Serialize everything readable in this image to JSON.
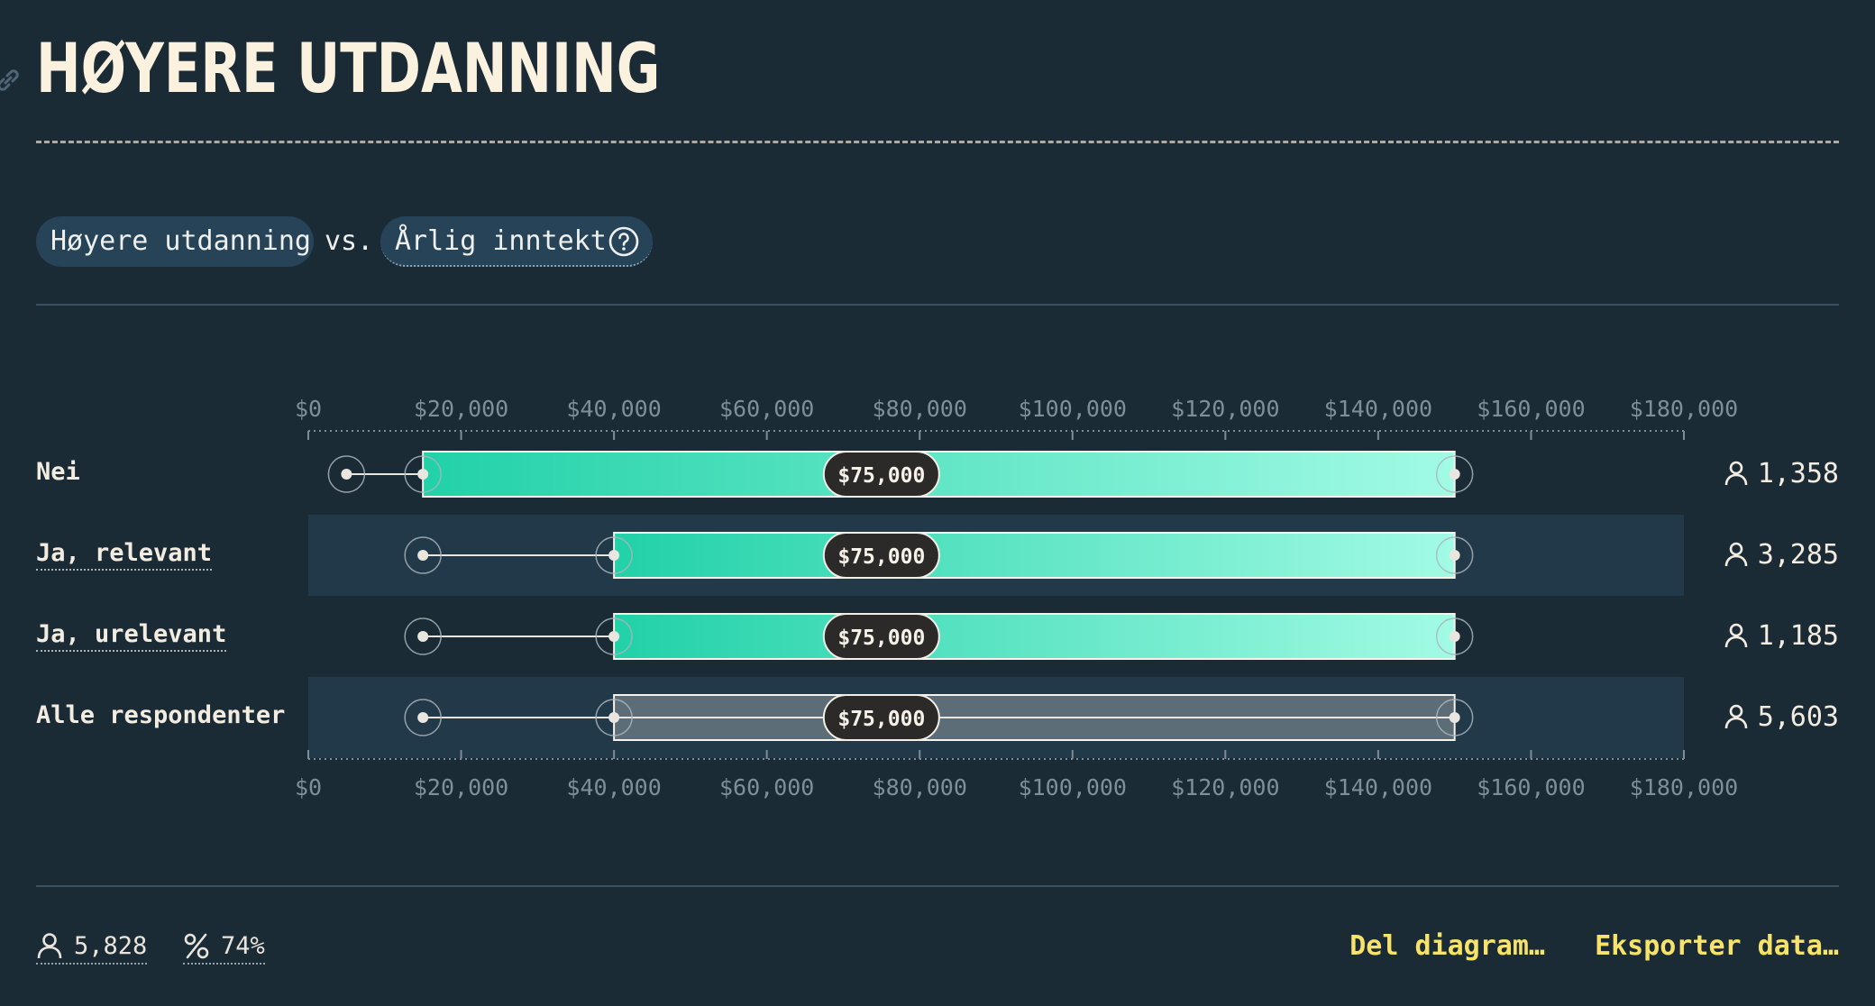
{
  "title": "HØYERE UTDANNING",
  "controls": {
    "variable_a": "Høyere utdanning",
    "vs_label": "vs.",
    "variable_b": "Årlig inntekt"
  },
  "chart_data": {
    "type": "box",
    "x_ticks": [
      "$0",
      "$20,000",
      "$40,000",
      "$60,000",
      "$80,000",
      "$100,000",
      "$120,000",
      "$140,000",
      "$160,000",
      "$180,000"
    ],
    "xlim": [
      0,
      180000
    ],
    "median_label": "$75,000",
    "rows": [
      {
        "name": "Nei",
        "min": 5000,
        "q1": 15000,
        "median": 75000,
        "q3": 150000,
        "max": 150000,
        "count": "1,358",
        "accent": "#21d1a8"
      },
      {
        "name": "Ja, relevant",
        "min": 15000,
        "q1": 40000,
        "median": 75000,
        "q3": 150000,
        "max": 150000,
        "count": "3,285",
        "accent": "#21d1a8"
      },
      {
        "name": "Ja, urelevant",
        "min": 15000,
        "q1": 40000,
        "median": 75000,
        "q3": 150000,
        "max": 150000,
        "count": "1,185",
        "accent": "#21d1a8"
      },
      {
        "name": "Alle respondenter",
        "min": 15000,
        "q1": 40000,
        "median": 75000,
        "q3": 150000,
        "max": 150000,
        "count": "5,603",
        "accent": "#5d6d78"
      }
    ]
  },
  "footer": {
    "respondents": "5,828",
    "percent": "74%",
    "share_label": "Del diagram…",
    "export_label": "Eksporter data…"
  },
  "colors": {
    "background": "#1b2b36",
    "stripe": "#213949",
    "action": "#f7e36a",
    "box_gradient_start": "#21d1a8",
    "box_gradient_end": "#a2fbe4"
  }
}
